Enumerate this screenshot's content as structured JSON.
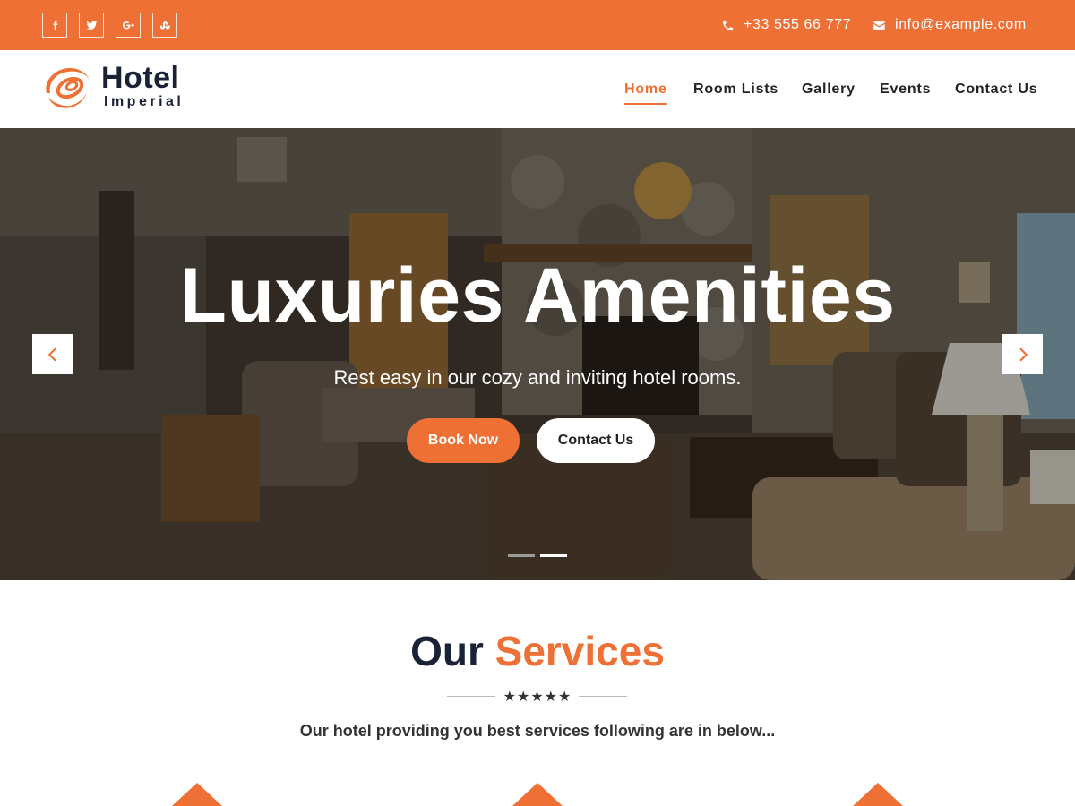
{
  "topbar": {
    "social": [
      "facebook",
      "twitter",
      "google-plus",
      "stumbleupon"
    ],
    "phone": "+33 555 66 777",
    "email": "info@example.com",
    "bg_color": "#ee7035"
  },
  "header": {
    "logo_title": "Hotel",
    "logo_subtitle": "Imperial",
    "nav": [
      {
        "label": "Home",
        "active": true
      },
      {
        "label": "Room Lists",
        "active": false
      },
      {
        "label": "Gallery",
        "active": false
      },
      {
        "label": "Events",
        "active": false
      },
      {
        "label": "Contact Us",
        "active": false
      }
    ]
  },
  "hero": {
    "title": "Luxuries Amenities",
    "subtitle": "Rest easy in our cozy and inviting hotel rooms.",
    "primary_button": "Book Now",
    "secondary_button": "Contact Us",
    "slide_count": 2,
    "active_slide": 2
  },
  "services": {
    "title_part1": "Our",
    "title_part2": "Services",
    "stars": "★★★★★",
    "description": "Our hotel providing you best services following are in below..."
  },
  "colors": {
    "accent": "#ee7035",
    "dark": "#1a2236"
  }
}
